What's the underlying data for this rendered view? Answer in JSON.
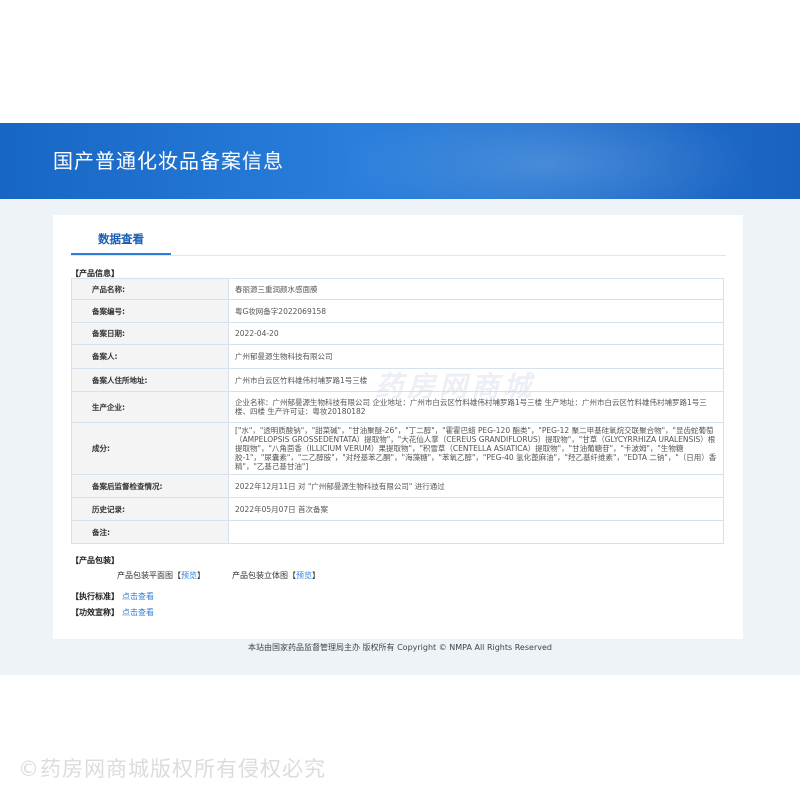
{
  "header": {
    "title": "国产普通化妆品备案信息"
  },
  "tabs": [
    {
      "label": "数据查看"
    }
  ],
  "sections": {
    "product_info": "【产品信息】",
    "packaging": "【产品包装】",
    "standard": "【执行标准】",
    "efficacy": "【功效宣称】"
  },
  "info_rows": [
    {
      "label": "产品名称:",
      "value": "春丽源三重润颜水感面膜"
    },
    {
      "label": "备案编号:",
      "value": "粤G妆网备字2022069158"
    },
    {
      "label": "备案日期:",
      "value": "2022-04-20"
    },
    {
      "label": "备案人:",
      "value": "广州郁曼源生物科技有限公司"
    },
    {
      "label": "备案人住所地址:",
      "value": "广州市白云区竹料雄伟村埔罗路1号三楼"
    },
    {
      "label": "生产企业:",
      "value": "企业名称：广州郁曼源生物科技有限公司 企业地址：广州市白云区竹料雄伟村埔罗路1号三楼 生产地址：广州市白云区竹料雄伟村埔罗路1号三楼、四楼 生产许可证：粤妆20180182"
    },
    {
      "label": "成分:",
      "value": "[\"水\"，\"透明质酸钠\"，\"甜菜碱\"，\"甘油聚醚-26\"，\"丁二醇\"，\"霍霍巴蜡 PEG-120 酯类\"，\"PEG-12 聚二甲基硅氧烷交联聚合物\"，\"显齿蛇葡萄（AMPELOPSIS GROSSEDENTATA）提取物\"，\"大花仙人掌（CEREUS GRANDIFLORUS）提取物\"，\"甘草（GLYCYRRHIZA URALENSIS）根提取物\"，\"八角茴香（ILLICIUM VERUM）果提取物\"，\"积雪草（CENTELLA ASIATICA）提取物\"，\"甘油葡糖苷\"，\"卡波姆\"，\"生物糖 胶-1\"，\"尿囊素\"，\"二乙醇胺\"，\"对羟基苯乙酮\"，\"海藻糖\"，\"苯氧乙醇\"，\"PEG-40 氢化蓖麻油\"，\"羟乙基纤维素\"，\"EDTA 二钠\"，\"（日用）香精\"，\"乙基己基甘油\"]"
    },
    {
      "label": "备案后监督检查情况:",
      "value": "2022年12月11日 对 \"广州郁曼源生物科技有限公司\" 进行通过"
    },
    {
      "label": "历史记录:",
      "value": "2022年05月07日 首次备案"
    },
    {
      "label": "备注:",
      "value": ""
    }
  ],
  "packaging": {
    "flat_label": "产品包装平面图",
    "solid_label": "产品包装立体图",
    "bracket_open": "【",
    "bracket_close": "】",
    "preview": "预览"
  },
  "links": {
    "view": "点击查看"
  },
  "footer": {
    "text": "本站由国家药品监督管理局主办 版权所有 Copyright © NMPA All Rights Reserved"
  },
  "watermark": {
    "bottom": "©药房网商城版权所有侵权必究",
    "center": "药房网商城"
  },
  "colors": {
    "banner": "#1f70d0",
    "accent": "#2a7fdc",
    "page_bg": "#eef3f8"
  }
}
